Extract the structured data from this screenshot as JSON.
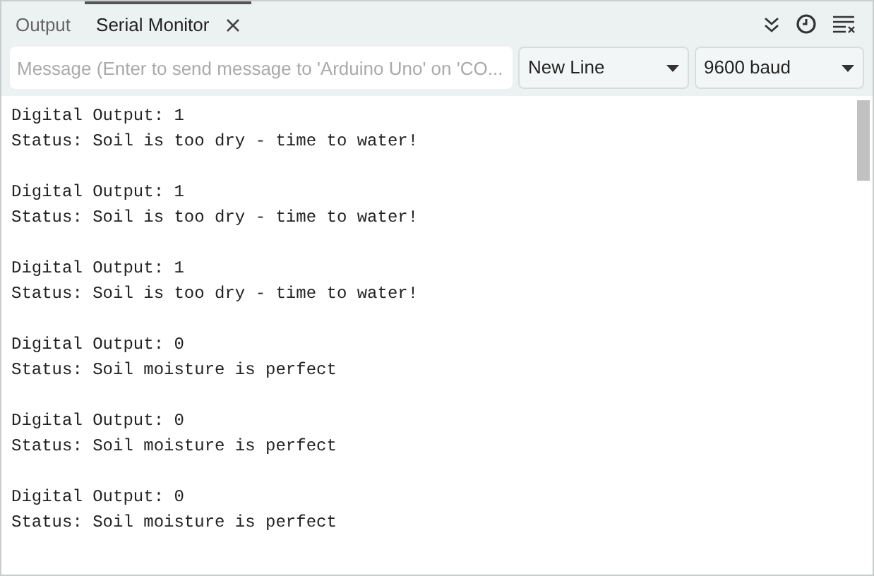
{
  "tabs": [
    {
      "label": "Output",
      "selected": false,
      "closable": false
    },
    {
      "label": "Serial Monitor",
      "selected": true,
      "closable": true
    }
  ],
  "message_field": {
    "placeholder": "Message (Enter to send message to 'Arduino Uno' on 'CO..."
  },
  "line_ending": "New Line",
  "baud_rate": "9600 baud",
  "entries": [
    {
      "lines": [
        "Digital Output: 1",
        "Status: Soil is too dry - time to water!"
      ]
    },
    {
      "lines": [
        "Digital Output: 1",
        "Status: Soil is too dry - time to water!"
      ]
    },
    {
      "lines": [
        "Digital Output: 1",
        "Status: Soil is too dry - time to water!"
      ]
    },
    {
      "lines": [
        "Digital Output: 0",
        "Status: Soil moisture is perfect"
      ]
    },
    {
      "lines": [
        "Digital Output: 0",
        "Status: Soil moisture is perfect"
      ]
    },
    {
      "lines": [
        "Digital Output: 0",
        "Status: Soil moisture is perfect"
      ]
    }
  ]
}
